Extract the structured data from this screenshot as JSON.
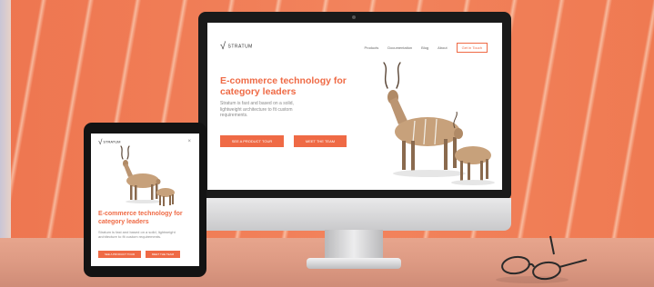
{
  "monitor_site": {
    "logo_text": "STRATUM",
    "nav": [
      "Products",
      "Documentation",
      "Blog",
      "About"
    ],
    "cta_label": "Get in Touch",
    "headline": "E-commerce technology for category leaders",
    "body": "Stratum is fast and based on a solid, lightweight architecture to fit custom requirements.",
    "button_primary": "SEE A PRODUCT TOUR",
    "button_secondary": "MEET THE TEAM"
  },
  "tablet_site": {
    "logo_text": "STRATUM",
    "menu_icon": "close-icon",
    "headline": "E-commerce technology for category leaders",
    "body": "Stratum is fast and based on a solid, lightweight architecture to fit custom requirements.",
    "button_primary": "SEE A PRODUCT TOUR",
    "button_secondary": "MEET THE TEAM"
  },
  "colors": {
    "accent": "#ef6a45",
    "wall": "#ef7a52"
  }
}
